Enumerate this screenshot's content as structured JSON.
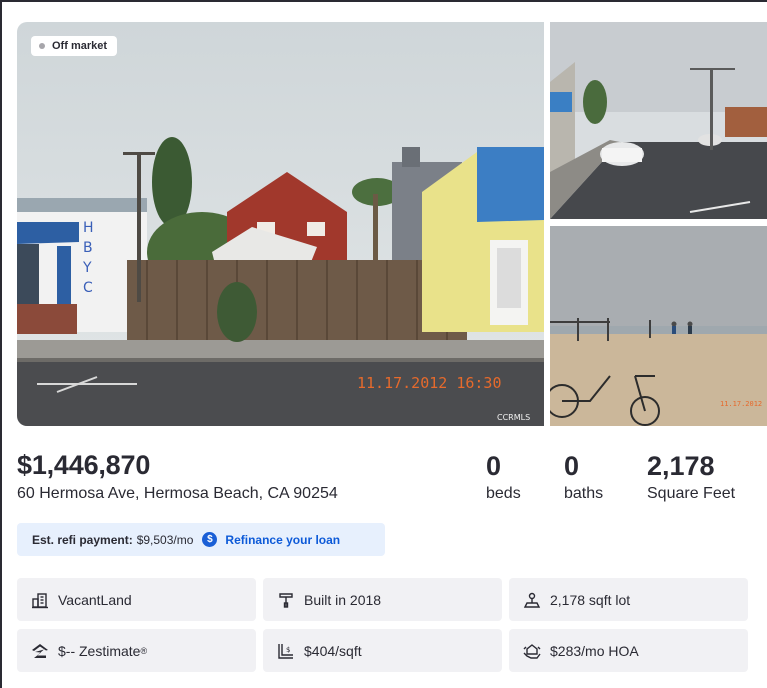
{
  "listing": {
    "status_badge": "Off market",
    "price": "$1,446,870",
    "address": "60 Hermosa Ave, Hermosa Beach, CA 90254",
    "photo_date_stamp": "11.17.2012 16:30",
    "photo_watermark": "CCRMLS"
  },
  "facts": {
    "beds": {
      "value": "0",
      "label": "beds"
    },
    "baths": {
      "value": "0",
      "label": "baths"
    },
    "sqft": {
      "value": "2,178",
      "label": "Square Feet"
    }
  },
  "refi": {
    "lead": "Est. refi payment:",
    "amount": "$9,503/mo",
    "icon_glyph": "$",
    "link": "Refinance your loan"
  },
  "details": {
    "type": "VacantLand",
    "built": "Built in 2018",
    "lot": "2,178 sqft lot",
    "zestimate": "$-- Zestimate",
    "zestimate_mark": "®",
    "price_per_sqft": "$404/sqft",
    "hoa": "$283/mo HOA"
  },
  "icons": {
    "type": "building-icon",
    "built": "hammer-icon",
    "lot": "lot-size-icon",
    "zestimate": "zillow-logo-icon",
    "price_per_sqft": "price-per-sqft-icon",
    "hoa": "hoa-icon"
  },
  "colors": {
    "text": "#2a2a33",
    "accent_blue": "#0d5ad8",
    "refi_bg": "#e7f0fd",
    "tile_bg": "#f1f1f4",
    "status_dot": "#a7a6ab"
  }
}
